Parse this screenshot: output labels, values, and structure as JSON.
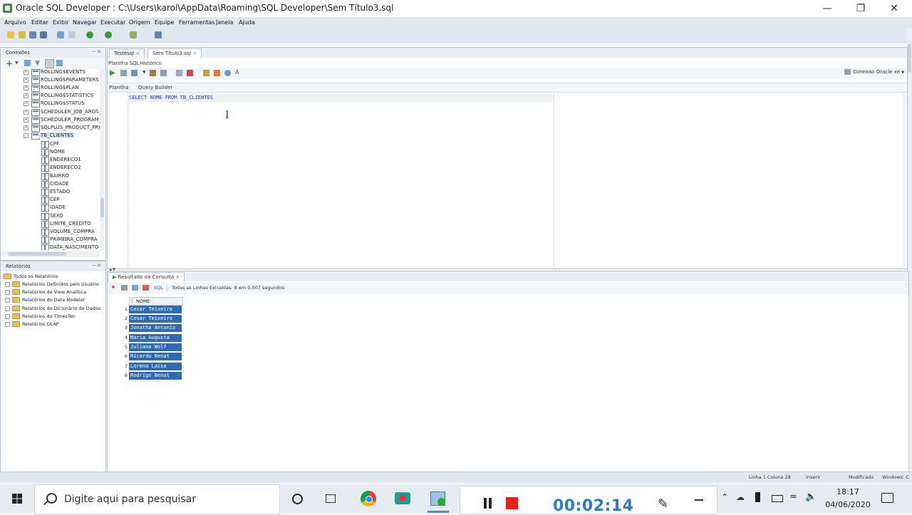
{
  "window": {
    "title": "Oracle SQL Developer : C:\\Users\\karol\\AppData\\Roaming\\SQL Developer\\Sem Título3.sql"
  },
  "menu": [
    "Arquivo",
    "Editar",
    "Exibir",
    "Navegar",
    "Executar",
    "Origem",
    "Equipe",
    "Ferramentas",
    "Janela",
    "Ajuda"
  ],
  "connections": {
    "header": "Conexões",
    "tables": [
      "ROLLING$EVENTS",
      "ROLLING$PARAMETERS",
      "ROLLING$PLAN",
      "ROLLING$STATISTICS",
      "ROLLING$STATUS",
      "SCHEDULER_JOB_ARGS_",
      "SCHEDULER_PROGRAM_",
      "SQLPLUS_PRODUCT_PRO",
      "TB_CLIENTES"
    ],
    "columns": [
      "CPF",
      "NOME",
      "ENDERECO1",
      "ENDERECO2",
      "BAIRRO",
      "CIDADE",
      "ESTADO",
      "CEP",
      "IDADE",
      "SEXO",
      "LIMITE_CREDITO",
      "VOLUME_COMPRA",
      "PRIMEIRA_COMPRA",
      "DATA_NASCIMENTO"
    ]
  },
  "reports": {
    "header": "Relatórios",
    "items": [
      "Todos os Relatórios",
      "Relatórios Definidos pelo Usuário",
      "Relatórios de View Analítica",
      "Relatórios do Data Modeler",
      "Relatórios do Dicionário de Dados",
      "Relatórios do TimesTen",
      "Relatórios OLAP"
    ]
  },
  "editor": {
    "tabs": [
      "Testesql",
      "Sem Título3.sql"
    ],
    "subtabs": [
      "Planilha SQL",
      "Histórico"
    ],
    "connection": "Conexao Oracle xe",
    "worksheet_tabs": [
      "Planilha",
      "Query Builder"
    ],
    "code": "SELECT NOME FROM TB_CLIENTES"
  },
  "results": {
    "tab": "Resultado da Consulta",
    "sql_link": "SQL",
    "message": "Todas as Linhas Extraídas: 8 em 0,007 segundos",
    "column": "NOME",
    "rows": [
      "Cesar Teixeira",
      "Cesar Teixeira",
      "Jonatha Antonio",
      "Maria Augusta",
      "Juliana Wolf",
      "Ricardo Benat",
      "Lorena Laisa",
      "Rodrigo Benat"
    ],
    "row_numbers": [
      "1",
      "2",
      "3",
      "4",
      "5",
      "6",
      "7",
      "8"
    ]
  },
  "status": {
    "position": "Linha 1 Coluna 28",
    "mode": "Inserir",
    "modified": "Modificado",
    "eol": "Windows: C"
  },
  "taskbar": {
    "search_placeholder": "Digite aqui para pesquisar",
    "timer": "00:02:14",
    "time": "18:17",
    "date": "04/06/2020"
  }
}
